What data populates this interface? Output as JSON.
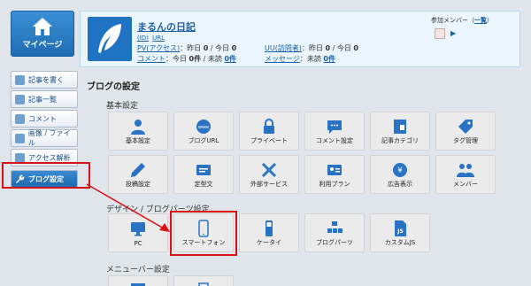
{
  "sidebar": {
    "mypage_label": "マイページ",
    "items": [
      {
        "label": "記事を書く",
        "color": "#6d9fd0"
      },
      {
        "label": "記事一覧",
        "color": "#6d9fd0"
      },
      {
        "label": "コメント",
        "color": "#6d9fd0"
      },
      {
        "label": "画像 / ファイル",
        "color": "#6d9fd0"
      },
      {
        "label": "アクセス解析",
        "color": "#6d9fd0"
      },
      {
        "label": "ブログ設定",
        "color": "#ffffff"
      }
    ]
  },
  "blog": {
    "title": "まるんの日記",
    "link_id": "(ID)",
    "link_url": "URL",
    "pv_label": "PV(アクセス)",
    "pv_text": "：昨日",
    "pv_y": "0",
    "pv_today_label": " / 今日",
    "pv_t": "0",
    "uu_label": "UU(訪問者)",
    "uu_text": "：昨日",
    "uu_y": "0",
    "uu_today_label": " / 今日",
    "uu_t": "0",
    "comment_label": "コメント",
    "comment_text": "：今日",
    "comment_today": "0件",
    "comment_unread_label": " / 未読",
    "comment_unread": "0件",
    "message_label": "メッセージ",
    "message_text": "：未読",
    "message_unread": "0件",
    "member_label": "参加メンバー",
    "member_list_link": "一覧"
  },
  "settings": {
    "title": "ブログの設定",
    "basic": {
      "title": "基本設定",
      "tiles": [
        "基本設定",
        "ブログURL",
        "プライベート",
        "コメント設定",
        "記事カテゴリ",
        "タグ管理",
        "投稿設定",
        "定型文",
        "外部サービス",
        "利用プラン",
        "広告表示",
        "メンバー"
      ]
    },
    "design": {
      "title": "デザイン / ブログパーツ設定",
      "tiles": [
        "PC",
        "スマートフォン",
        "ケータイ",
        "ブログパーツ",
        "カスタムJS"
      ]
    },
    "menubar": {
      "title": "メニューバー設定"
    }
  },
  "colors": {
    "accent": "#1f6db3",
    "tile_icon": "#2a72c2",
    "highlight": "#d81212"
  }
}
